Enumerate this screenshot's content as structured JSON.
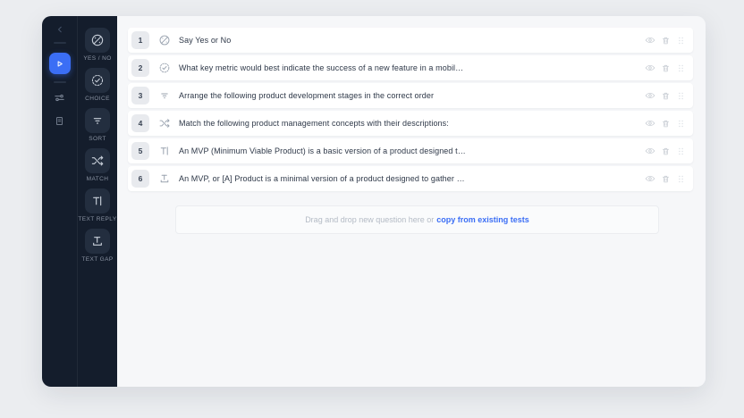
{
  "colors": {
    "accent": "#3b6ef5",
    "sidebar_bg": "#141d2c",
    "type_button_bg": "#232e3f",
    "main_bg": "#f6f7f9",
    "row_bg": "#ffffff",
    "link": "#3b6ef5"
  },
  "icons": {
    "rail": [
      "chevron-left-icon",
      "play-icon",
      "sliders-icon",
      "document-icon"
    ],
    "row_actions": [
      "eye-icon",
      "trash-icon",
      "drag-handle-icon"
    ]
  },
  "sidebar": {
    "types": [
      {
        "label": "YES / NO",
        "icon": "yes-no-icon"
      },
      {
        "label": "CHOICE",
        "icon": "choice-icon"
      },
      {
        "label": "SORT",
        "icon": "sort-icon"
      },
      {
        "label": "MATCH",
        "icon": "match-icon"
      },
      {
        "label": "TEXT REPLY",
        "icon": "text-reply-icon"
      },
      {
        "label": "TEXT GAP",
        "icon": "text-gap-icon"
      }
    ]
  },
  "questions": [
    {
      "number": "1",
      "type": "yes-no",
      "text": "Say Yes or No"
    },
    {
      "number": "2",
      "type": "choice",
      "text": "What key metric would best indicate the success of a new feature in a mobil…"
    },
    {
      "number": "3",
      "type": "sort",
      "text": "Arrange the following product development stages in the correct order"
    },
    {
      "number": "4",
      "type": "match",
      "text": "Match the following product management concepts with their descriptions:"
    },
    {
      "number": "5",
      "type": "text-reply",
      "text": "An MVP (Minimum Viable Product) is a basic version of a product designed t…"
    },
    {
      "number": "6",
      "type": "text-gap",
      "text": "An MVP, or [A] Product is a minimal version of a product designed to gather …"
    }
  ],
  "dropzone": {
    "text": "Drag and drop new question here or",
    "link": "copy from existing tests"
  }
}
